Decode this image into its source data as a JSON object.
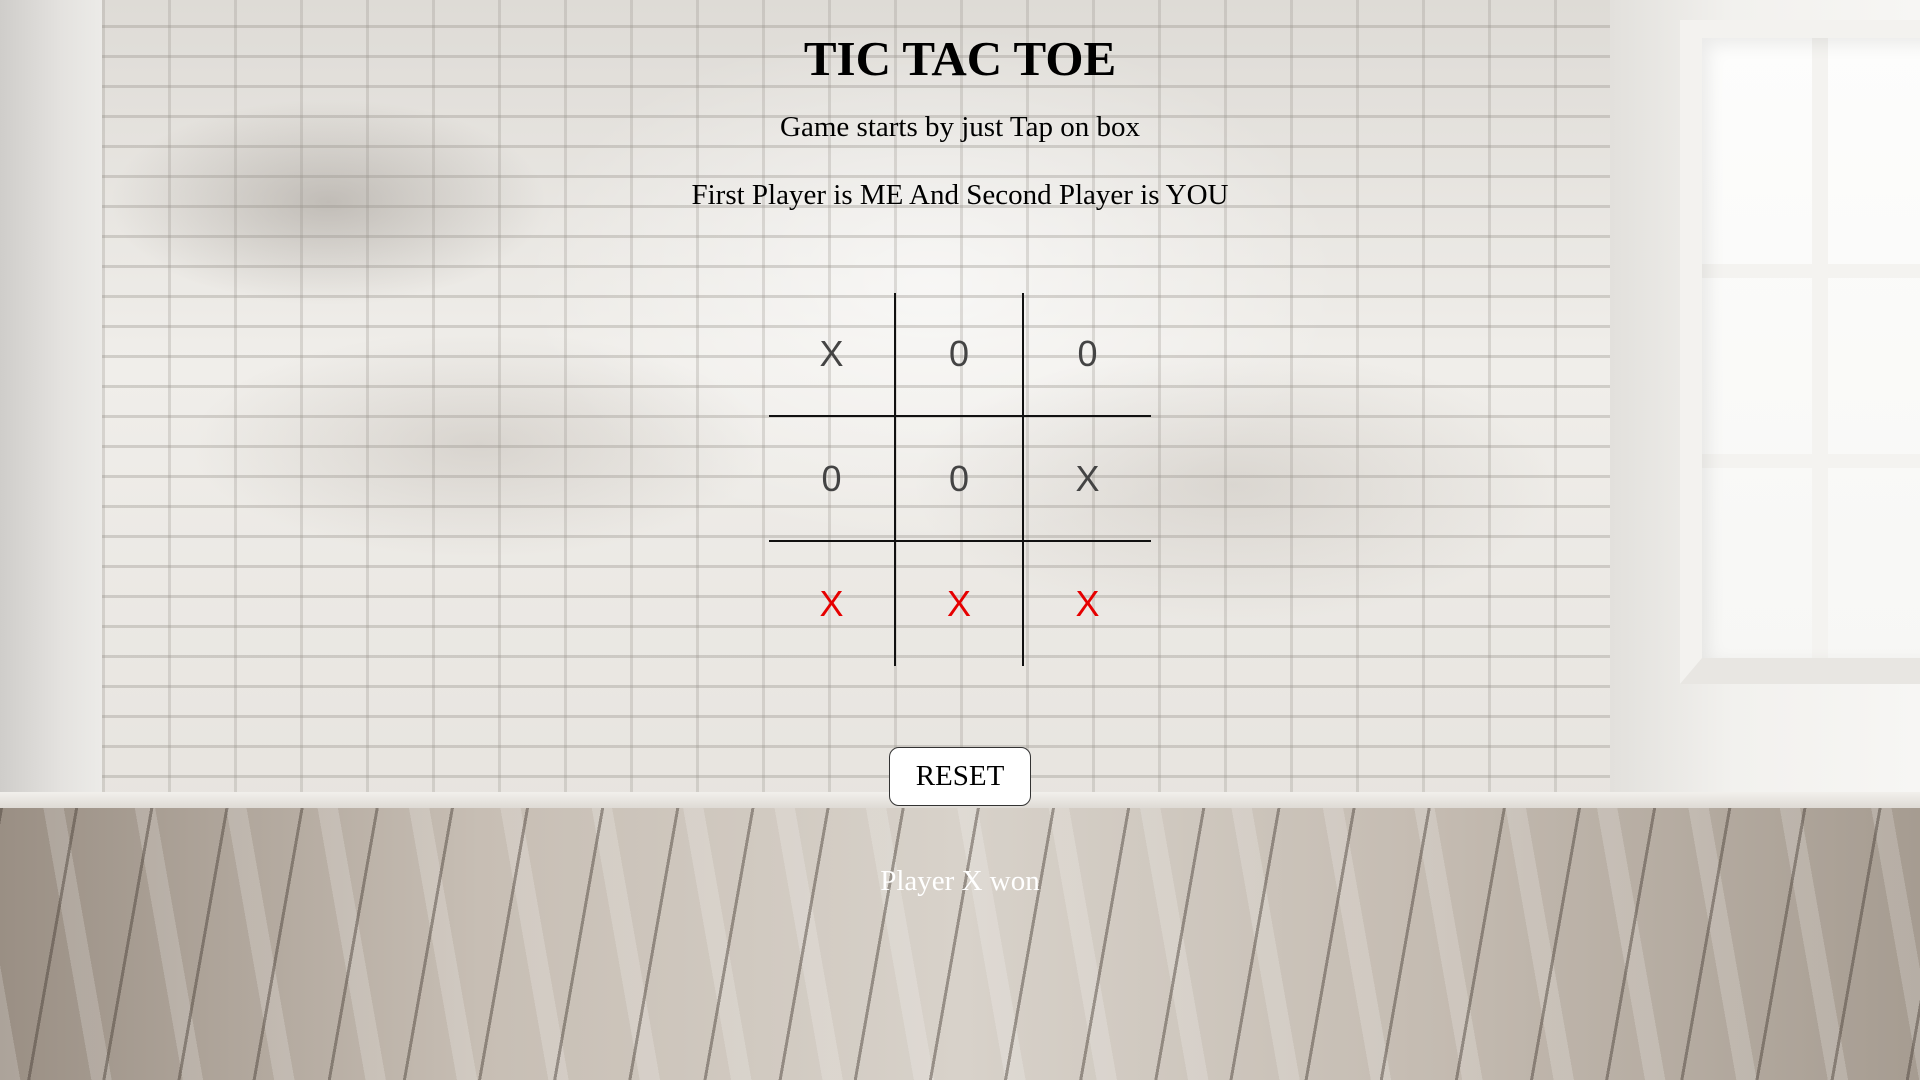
{
  "header": {
    "title": "TIC TAC TOE",
    "subtitle": "Game starts by just Tap on box",
    "players_info": "First Player is ME And Second Player is YOU"
  },
  "board": {
    "cells": [
      {
        "value": "X",
        "highlight": false
      },
      {
        "value": "0",
        "highlight": false
      },
      {
        "value": "0",
        "highlight": false
      },
      {
        "value": "0",
        "highlight": false
      },
      {
        "value": "0",
        "highlight": false
      },
      {
        "value": "X",
        "highlight": false
      },
      {
        "value": "X",
        "highlight": true
      },
      {
        "value": "X",
        "highlight": true
      },
      {
        "value": "X",
        "highlight": true
      }
    ],
    "win_color": "#e60000",
    "mark_color": "#444444"
  },
  "controls": {
    "reset_label": "RESET"
  },
  "status": {
    "message": "Player X won"
  }
}
